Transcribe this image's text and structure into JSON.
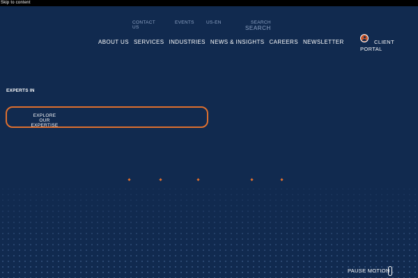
{
  "skip_link": "Skip to content",
  "utility_nav": {
    "contact": "CONTACT US",
    "events": "EVENTS",
    "language": "US-EN",
    "search_label": "SEARCH",
    "search_placeholder": "SEARCH"
  },
  "main_nav": [
    "ABOUT US",
    "SERVICES",
    "INDUSTRIES",
    "NEWS & INSIGHTS",
    "CAREERS",
    "NEWSLETTER"
  ],
  "client_portal": {
    "line1": "CLIENT",
    "line2": "PORTAL"
  },
  "hero": {
    "experts_label": "EXPERTS IN",
    "explore_button": "EXPLORE OUR EXPERTISE"
  },
  "pause_motion": "PAUSE MOTION",
  "colors": {
    "background": "#112a4f",
    "accent": "#e0702e",
    "muted_text": "#8ea3c4"
  }
}
